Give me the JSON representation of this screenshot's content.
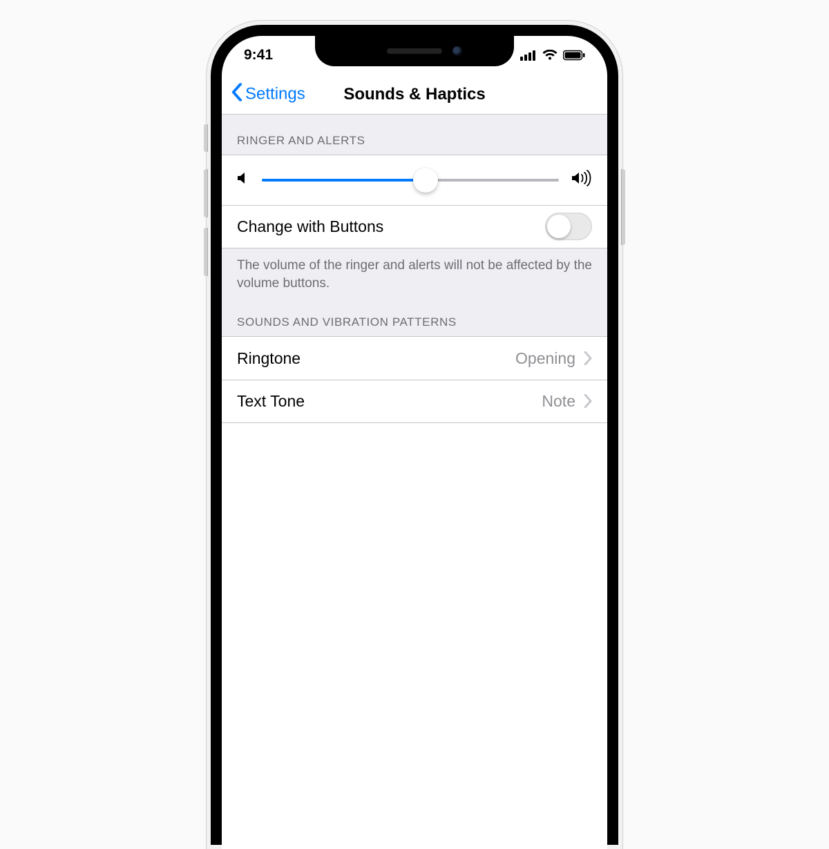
{
  "statusbar": {
    "time": "9:41"
  },
  "navbar": {
    "back_label": "Settings",
    "title": "Sounds & Haptics"
  },
  "sections": {
    "ringer": {
      "header": "RINGER AND ALERTS",
      "slider_percent": 55,
      "toggle_label": "Change with Buttons",
      "toggle_on": false,
      "footer": "The volume of the ringer and alerts will not be affected by the volume buttons."
    },
    "patterns": {
      "header": "SOUNDS AND VIBRATION PATTERNS",
      "rows": [
        {
          "label": "Ringtone",
          "value": "Opening"
        },
        {
          "label": "Text Tone",
          "value": "Note"
        }
      ]
    }
  }
}
